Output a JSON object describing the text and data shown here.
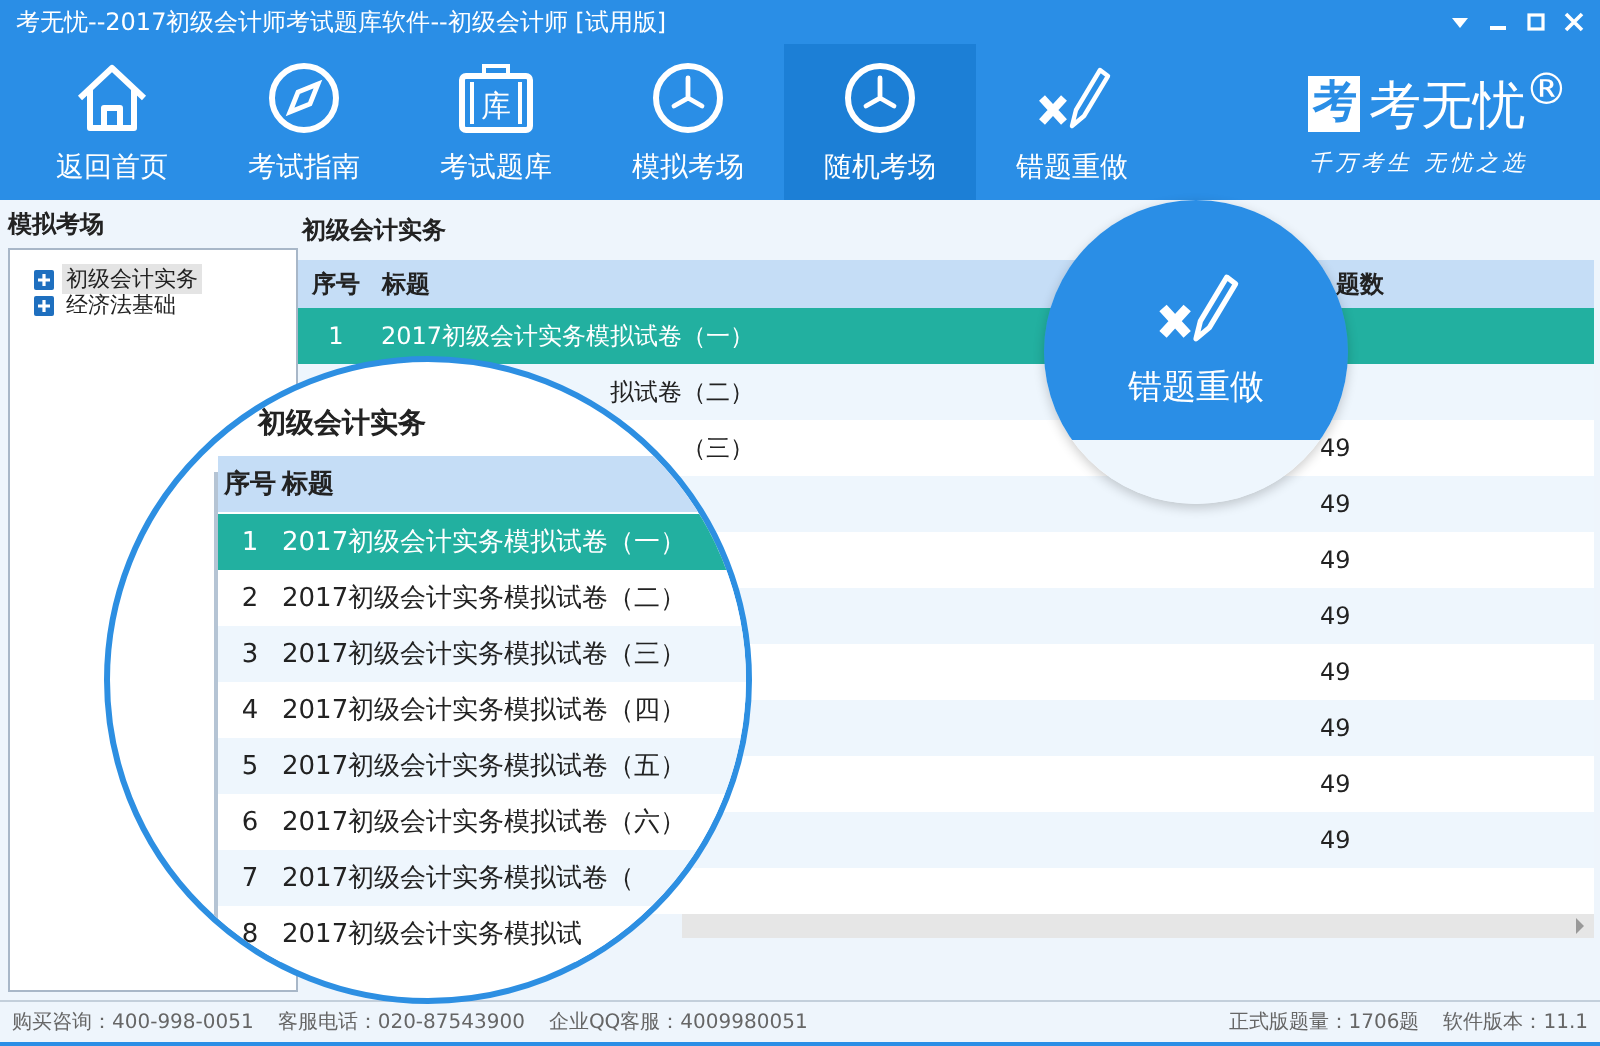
{
  "window": {
    "title": "考无忧--2017初级会计师考试题库软件--初级会计师 [试用版]"
  },
  "toolbar": [
    {
      "label": "返回首页",
      "selected": false
    },
    {
      "label": "考试指南",
      "selected": false
    },
    {
      "label": "考试题库",
      "icon_text": "库",
      "selected": false
    },
    {
      "label": "模拟考场",
      "selected": false
    },
    {
      "label": "随机考场",
      "selected": true
    },
    {
      "label": "错题重做",
      "selected": false
    }
  ],
  "logo": {
    "mark": "考",
    "name": "考无忧$^{®}$",
    "slogan": "千万考生 无忧之选"
  },
  "sidebar": {
    "title": "模拟考场",
    "items": [
      {
        "label": "初级会计实务",
        "expanded": false,
        "selected": true
      },
      {
        "label": "经济法基础",
        "expanded": false,
        "selected": false
      }
    ]
  },
  "table": {
    "caption": "初级会计实务",
    "columns": [
      "序号",
      "标题",
      "题数"
    ],
    "rows": [
      {
        "number": "1",
        "title": "2017初级会计实务模拟试卷（一）",
        "selected": true
      },
      {
        "title": "拟试卷（二）",
        "selected": false
      },
      {
        "title": "（三）",
        "count": "49",
        "selected": false
      },
      {
        "count": "49",
        "selected": false
      },
      {
        "count": "49",
        "selected": false
      },
      {
        "count": "49",
        "selected": false
      },
      {
        "count": "49",
        "selected": false
      },
      {
        "count": "49",
        "selected": false
      },
      {
        "count": "49",
        "selected": false
      },
      {
        "count": "49",
        "selected": false
      }
    ]
  },
  "magnifier": {
    "caption": "初级会计实务",
    "columns": [
      "序号",
      "标题"
    ],
    "rows": [
      {
        "number": "1",
        "title": "2017初级会计实务模拟试卷（一）",
        "selected": true
      },
      {
        "number": "2",
        "title": "2017初级会计实务模拟试卷（二）",
        "selected": false
      },
      {
        "number": "3",
        "title": "2017初级会计实务模拟试卷（三）",
        "selected": false
      },
      {
        "number": "4",
        "title": "2017初级会计实务模拟试卷（四）",
        "selected": false
      },
      {
        "number": "5",
        "title": "2017初级会计实务模拟试卷（五）",
        "selected": false
      },
      {
        "number": "6",
        "title": "2017初级会计实务模拟试卷（六）",
        "selected": false
      },
      {
        "number": "7",
        "title": "2017初级会计实务模拟试卷（",
        "selected": false
      },
      {
        "number": "8",
        "title": "2017初级会计实务模拟试",
        "selected": false
      }
    ]
  },
  "zoom_badge": {
    "label": "错题重做"
  },
  "status_bar": {
    "left": [
      "购买咨询：400-998-0051",
      "客服电话：020-87543900",
      "企业QQ客服：4009980051"
    ],
    "right": [
      "正式版题量：1706题",
      "软件版本：11.1"
    ]
  }
}
